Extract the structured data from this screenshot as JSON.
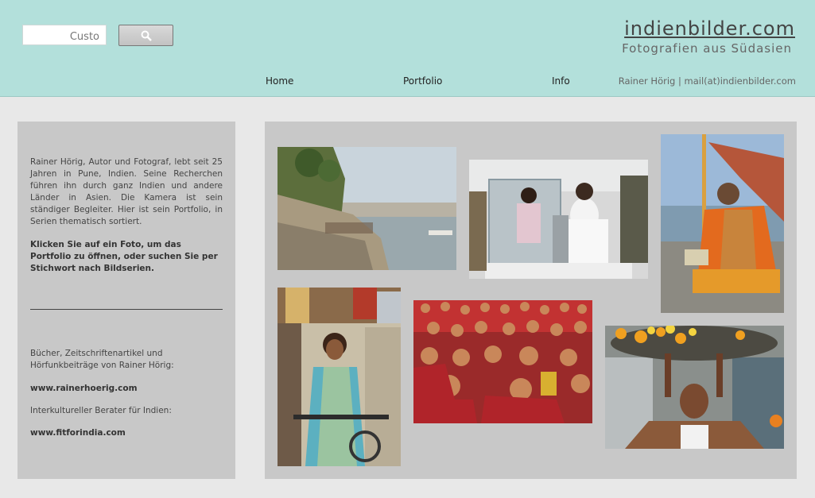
{
  "search": {
    "placeholder": "Custo",
    "button_icon": "search-icon"
  },
  "site": {
    "title": "indienbilder.com",
    "subtitle": "Fotografien aus Südasien"
  },
  "nav": {
    "home": "Home",
    "portfolio": "Portfolio",
    "info": "Info",
    "credit": "Rainer Hörig | mail(at)indienbilder.com"
  },
  "sidebar": {
    "intro": "Rainer Hörig, Autor und Fotograf, lebt seit 25 Jahren in Pune, Indien. Seine Recherchen führen ihn durch ganz Indien und andere Länder in Asien. Die Kamera ist sein ständiger Begleiter. Hier ist sein Portfolio, in Serien thematisch sortiert.",
    "cta": "Klicken Sie auf ein Foto, um das Portfolio zu öffnen, oder suchen Sie per Stichwort nach Bildserien.",
    "books_label": "Bücher, Zeitschriftenartikel und Hörfunkbeiträge von Rainer Hörig:",
    "books_link": "www.rainerhoerig.com",
    "consultant_label": "Interkultureller Berater für Indien:",
    "consultant_link": "www.fitforindia.com"
  },
  "colors": {
    "header": "#b3e0db",
    "panel": "#c8c8c8",
    "background": "#e8e8e8"
  }
}
